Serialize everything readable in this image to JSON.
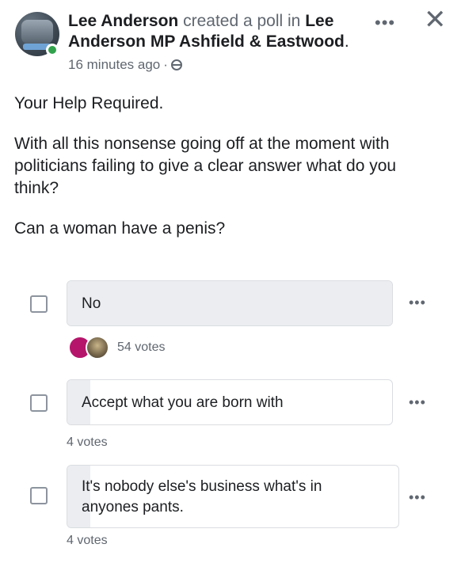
{
  "post": {
    "author": "Lee Anderson",
    "action": "created a poll in",
    "group_part1": "Lee",
    "group_part2": "Anderson MP Ashfield & Eastwood",
    "period": ".",
    "time": "16 minutes ago",
    "separator": "·",
    "more_label": "•••",
    "close_label": "✕"
  },
  "body": {
    "line1": "Your Help Required.",
    "line2": "With all this nonsense going off at the moment with politicians failing to give a clear answer what do you think?",
    "line3": "Can a woman have a penis?"
  },
  "poll": {
    "options": [
      {
        "label": "No",
        "votes": "54 votes",
        "fill_fraction": 1.0
      },
      {
        "label": "Accept what you are born with",
        "votes": "4 votes",
        "fill_fraction": 0.07
      },
      {
        "label": "It's nobody else's business what's in anyones pants.",
        "votes": "4 votes",
        "fill_fraction": 0.07
      }
    ],
    "option_more_label": "•••"
  },
  "icons": {
    "close": "close-icon",
    "more": "more-icon",
    "globe": "globe-icon",
    "online": "online-status-icon"
  },
  "colors": {
    "text": "#1c1e21",
    "muted": "#606770",
    "fill": "#ebedf0",
    "online": "#31a24c"
  }
}
